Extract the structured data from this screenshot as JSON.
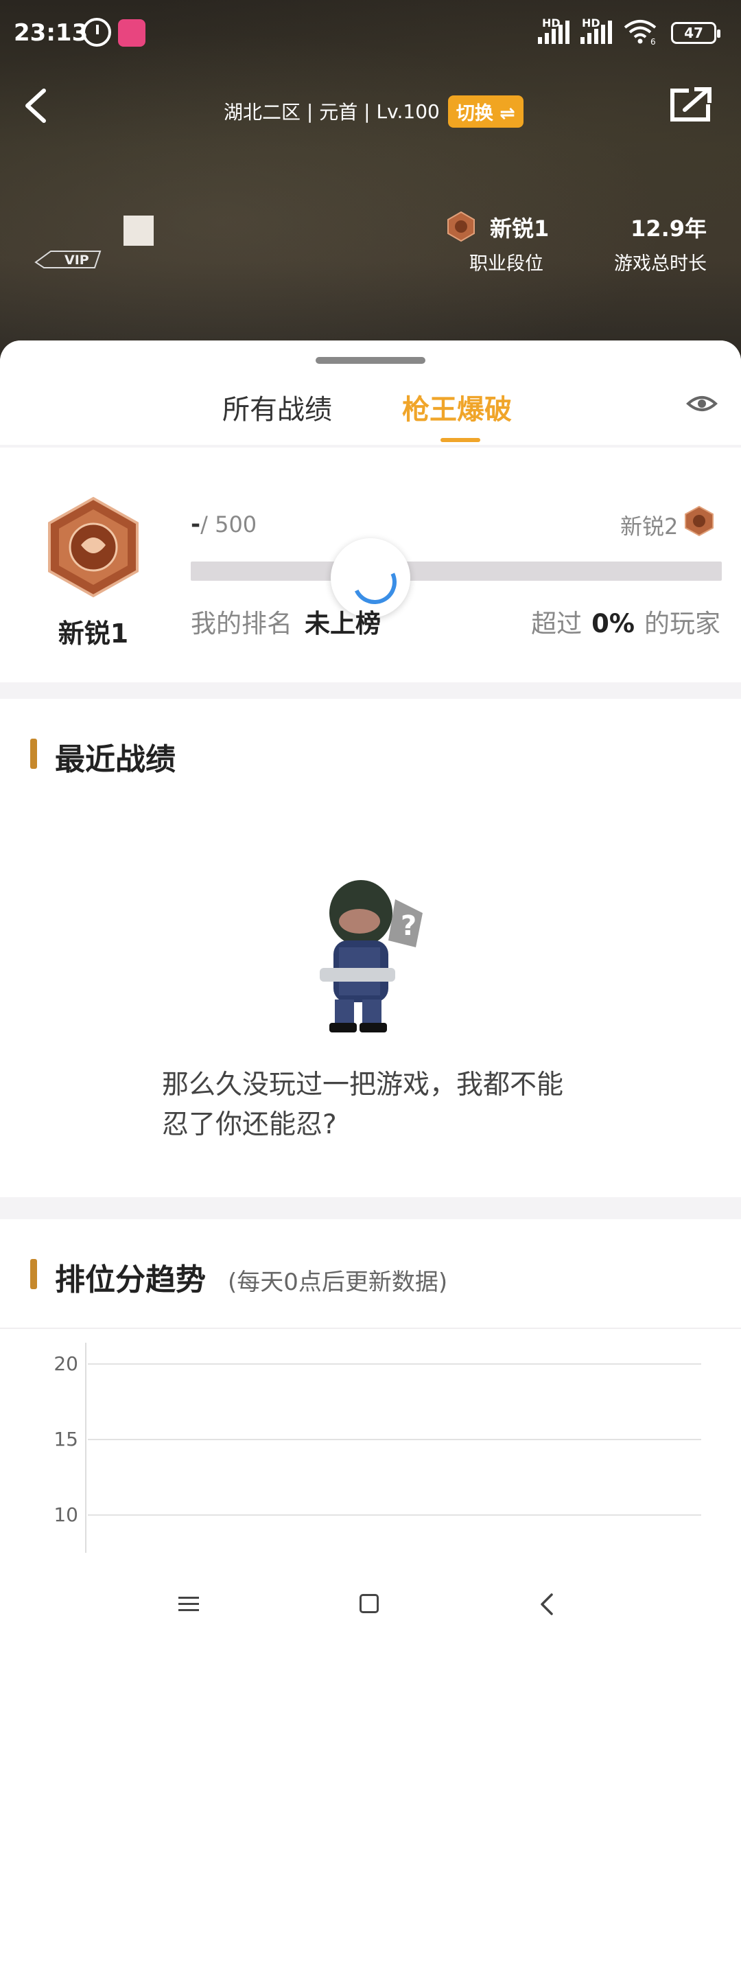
{
  "status_bar": {
    "time": "23:13",
    "hd1": "HD",
    "hd2": "HD",
    "wifi_label": "6",
    "battery": "47"
  },
  "header": {
    "server": "湖北二区",
    "separator1": " | ",
    "name": "元首",
    "separator2": " | ",
    "level": "Lv.100",
    "switch_label": "切换 ⇌",
    "vip_label": "VIP"
  },
  "profile_stats": {
    "rank_value": "新锐1",
    "rank_label": "职业段位",
    "playtime_value": "12.9年",
    "playtime_label": "游戏总时长"
  },
  "tabs": [
    {
      "label": "所有战绩",
      "active": false
    },
    {
      "label": "枪王爆破",
      "active": true
    }
  ],
  "rank_card": {
    "medal_name": "新锐1",
    "score_current": "-",
    "score_total": "/ 500",
    "next_rank": "新锐2",
    "progress": 0,
    "my_rank_label": "我的排名",
    "my_rank_value": "未上榜",
    "exceed_prefix": "超过",
    "exceed_value": "0%",
    "exceed_suffix": "的玩家"
  },
  "recent": {
    "title": "最近战绩",
    "empty_message": "那么久没玩过一把游戏，我都不能忍了你还能忍?"
  },
  "trend": {
    "title": "排位分趋势",
    "subtitle": "(每天0点后更新数据)"
  },
  "chart_data": {
    "type": "line",
    "ylim": [
      10,
      20
    ],
    "yticks": [
      "20",
      "15",
      "10"
    ],
    "series": []
  },
  "icons": {
    "back": "chevron-left-icon",
    "share": "share-icon",
    "eye": "eye-icon"
  },
  "colors": {
    "accent": "#f0a52a",
    "section_bar": "#c6882b",
    "loader": "#3a8ee6"
  }
}
